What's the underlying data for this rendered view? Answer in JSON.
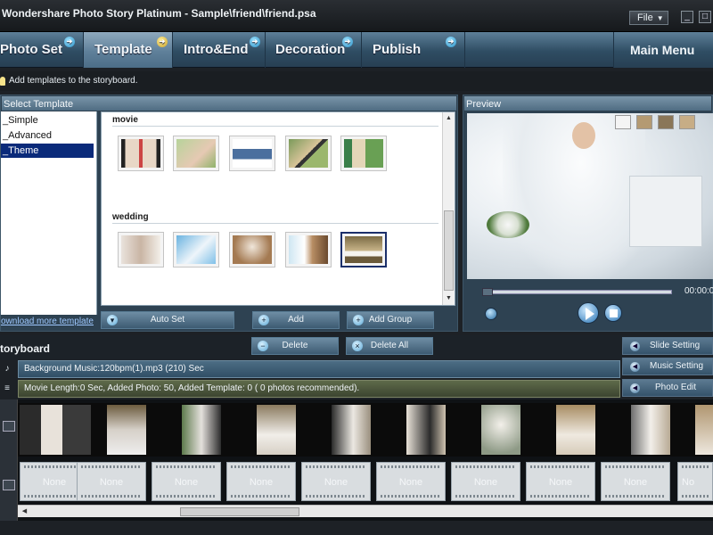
{
  "window": {
    "title": "Wondershare Photo Story Platinum - Sample\\friend\\friend.psa",
    "file_menu": "File",
    "minimize": "_",
    "maximize": "□"
  },
  "nav": {
    "tabs": [
      {
        "label": "Photo Set"
      },
      {
        "label": "Template"
      },
      {
        "label": "Intro&End"
      },
      {
        "label": "Decoration"
      },
      {
        "label": "Publish"
      }
    ],
    "active": "Template",
    "main_menu": "Main Menu"
  },
  "hint": "Add templates to the storyboard.",
  "select_template": {
    "title": "Select Template",
    "tree": [
      "_Simple",
      "_Advanced",
      "_Theme"
    ],
    "selected_tree_item": "_Theme",
    "groups": [
      {
        "label": "movie",
        "count": 5
      },
      {
        "label": "wedding",
        "count": 5,
        "selected_index": 4
      }
    ],
    "download_link": "ownload more template",
    "buttons": {
      "auto_set": "Auto Set",
      "add": "Add",
      "add_group": "Add  Group",
      "delete": "Delete",
      "delete_all": "Delete All"
    }
  },
  "preview": {
    "title": "Preview",
    "time": "00:00:0",
    "progress": 0
  },
  "storyboard": {
    "title": "toryboard",
    "music": "Background Music:120bpm(1).mp3 (210) Sec",
    "info": "Movie Length:0 Sec,   Added Photo: 50,   Added Template: 0   ( 0 photos recommended).",
    "side_buttons": {
      "slide_setting": "Slide Setting",
      "music_setting": "Music Setting",
      "photo_edit": "Photo Edit"
    },
    "slots": [
      "None",
      "None",
      "None",
      "None",
      "None",
      "None",
      "None",
      "None",
      "None",
      "No"
    ]
  },
  "colors": {
    "accent": "#5f809a",
    "selection": "#0a2a7a"
  }
}
